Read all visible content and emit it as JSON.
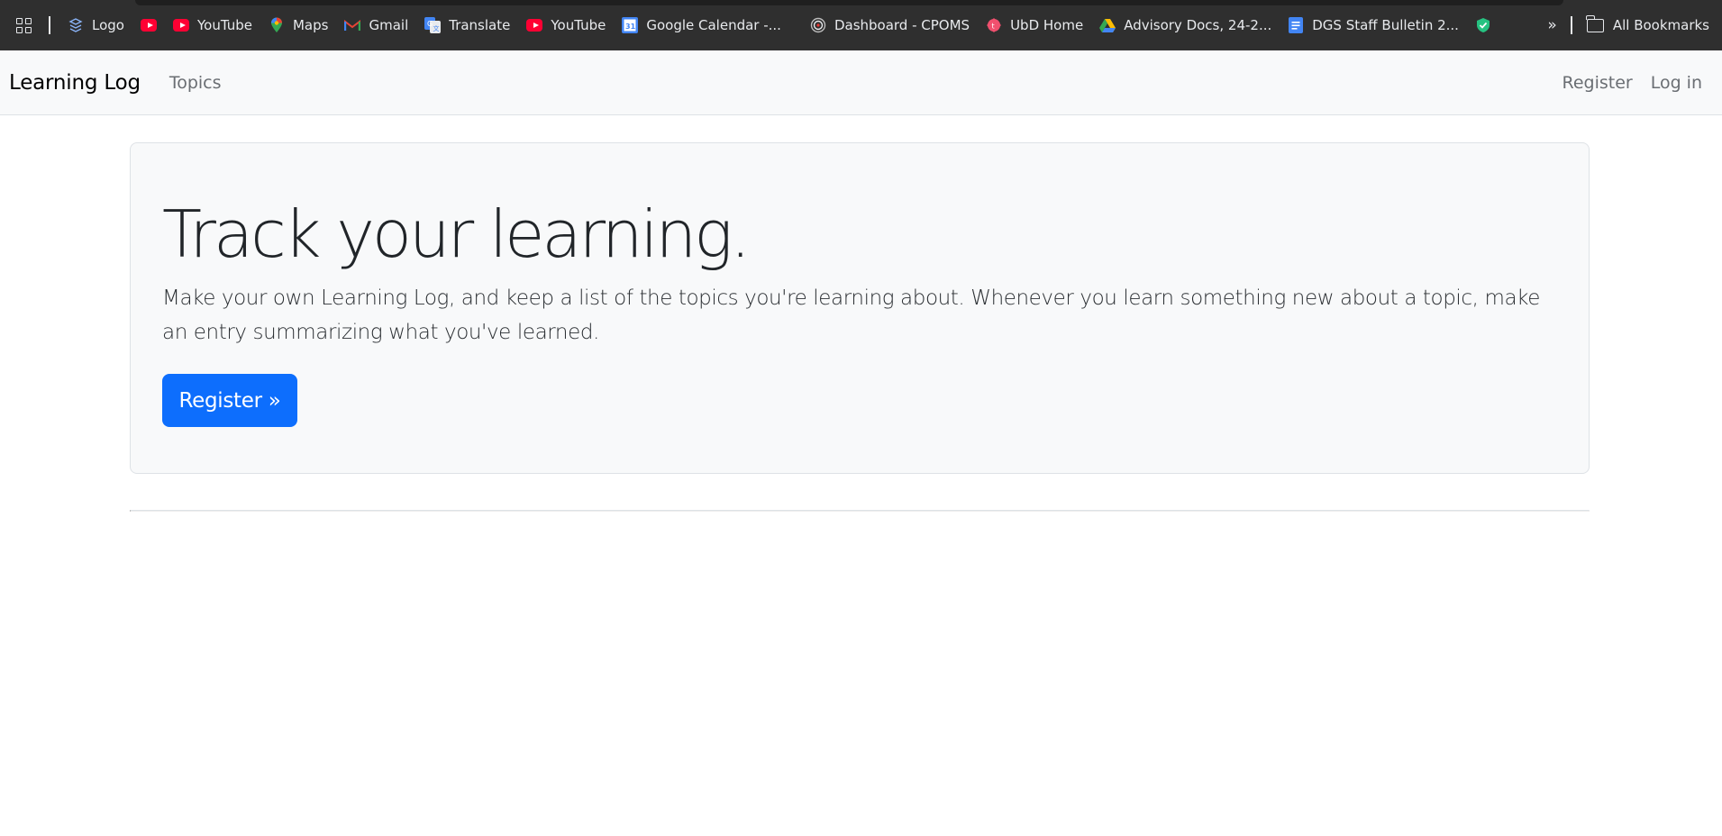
{
  "browser": {
    "bookmarks": [
      {
        "label": "Logo",
        "icon": "stack-logo-icon"
      },
      {
        "label": "",
        "icon": "youtube-icon"
      },
      {
        "label": "YouTube",
        "icon": "youtube-icon"
      },
      {
        "label": "Maps",
        "icon": "google-maps-icon"
      },
      {
        "label": "Gmail",
        "icon": "gmail-icon"
      },
      {
        "label": "Translate",
        "icon": "google-translate-icon"
      },
      {
        "label": "YouTube",
        "icon": "youtube-icon"
      },
      {
        "label": "Google Calendar -...",
        "icon": "google-calendar-icon"
      },
      {
        "label": "Dashboard - CPOMS",
        "icon": "cpoms-icon"
      },
      {
        "label": "UbD Home",
        "icon": "ubd-icon"
      },
      {
        "label": "Advisory Docs, 24-2...",
        "icon": "google-drive-icon"
      },
      {
        "label": "DGS Staff Bulletin 2...",
        "icon": "google-docs-icon"
      },
      {
        "label": "",
        "icon": "shield-check-icon"
      }
    ],
    "all_bookmarks_label": "All Bookmarks",
    "overflow_label": "»",
    "bar_color": "#2f2f2f"
  },
  "navbar": {
    "brand": "Learning Log",
    "links_left": [
      "Topics"
    ],
    "links_right": [
      "Register",
      "Log in"
    ]
  },
  "hero": {
    "title": "Track your learning.",
    "lead": "Make your own Learning Log, and keep a list of the topics you're learning about. Whenever you learn something new about a topic, make an entry summarizing what you've learned.",
    "button_label": "Register »",
    "button_color": "#0d6efd"
  }
}
